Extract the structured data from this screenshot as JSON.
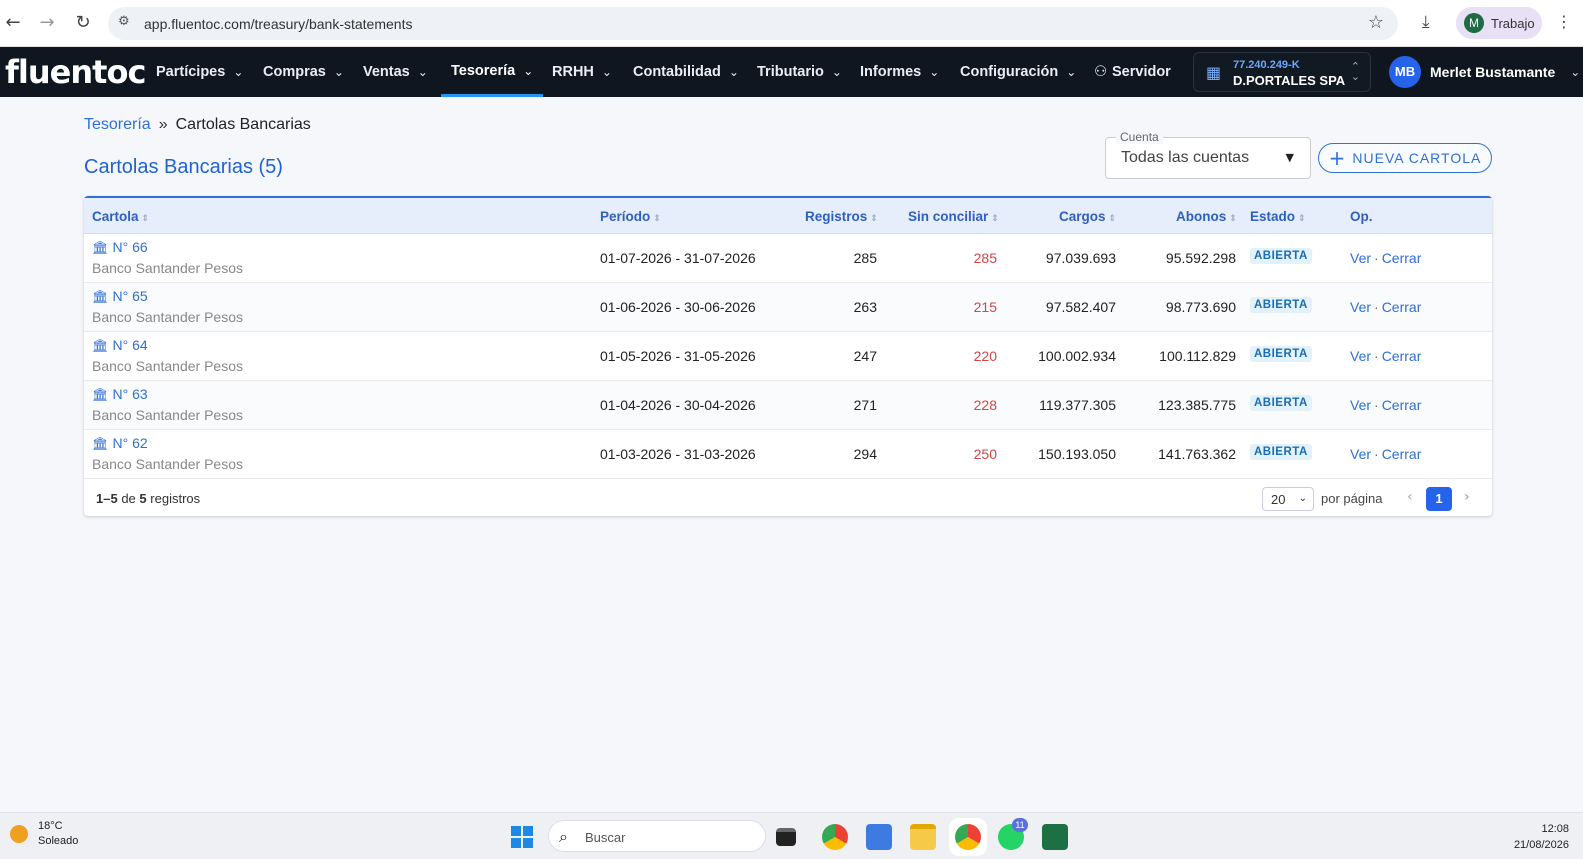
{
  "browser": {
    "url": "app.fluentoc.com/treasury/bank-statements",
    "profile_initial": "M",
    "profile_label": "Trabajo"
  },
  "app": {
    "logo": "fluentoc",
    "menu": [
      {
        "label": "Partícipes",
        "active": false
      },
      {
        "label": "Compras",
        "active": false
      },
      {
        "label": "Ventas",
        "active": false
      },
      {
        "label": "Tesorería",
        "active": true
      },
      {
        "label": "RRHH",
        "active": false
      },
      {
        "label": "Contabilidad",
        "active": false
      },
      {
        "label": "Tributario",
        "active": false
      },
      {
        "label": "Informes",
        "active": false
      },
      {
        "label": "Configuración",
        "active": false
      }
    ],
    "server_label": "Servidor",
    "company": {
      "rut": "77.240.249-K",
      "name": "D.PORTALES SPA"
    },
    "user": {
      "initials": "MB",
      "name": "Merlet Bustamante"
    }
  },
  "breadcrumb": {
    "parent": "Tesorería",
    "separator": "»",
    "current": "Cartolas Bancarias"
  },
  "page_title": "Cartolas Bancarias (5)",
  "account_filter": {
    "label": "Cuenta",
    "value": "Todas las cuentas"
  },
  "new_button": "NUEVA CARTOLA",
  "table": {
    "headers": {
      "cartola": "Cartola",
      "periodo": "Período",
      "registros": "Registros",
      "sin_conciliar": "Sin conciliar",
      "cargos": "Cargos",
      "abonos": "Abonos",
      "estado": "Estado",
      "op": "Op."
    },
    "rows": [
      {
        "id": "N° 66",
        "bank": "Banco Santander Pesos",
        "periodo": "01-07-2026 - 31-07-2026",
        "registros": "285",
        "sin_conciliar": "285",
        "cargos": "97.039.693",
        "abonos": "95.592.298",
        "estado": "ABIERTA",
        "ver": "Ver",
        "cerrar": "Cerrar"
      },
      {
        "id": "N° 65",
        "bank": "Banco Santander Pesos",
        "periodo": "01-06-2026 - 30-06-2026",
        "registros": "263",
        "sin_conciliar": "215",
        "cargos": "97.582.407",
        "abonos": "98.773.690",
        "estado": "ABIERTA",
        "ver": "Ver",
        "cerrar": "Cerrar"
      },
      {
        "id": "N° 64",
        "bank": "Banco Santander Pesos",
        "periodo": "01-05-2026 - 31-05-2026",
        "registros": "247",
        "sin_conciliar": "220",
        "cargos": "100.002.934",
        "abonos": "100.112.829",
        "estado": "ABIERTA",
        "ver": "Ver",
        "cerrar": "Cerrar"
      },
      {
        "id": "N° 63",
        "bank": "Banco Santander Pesos",
        "periodo": "01-04-2026 - 30-04-2026",
        "registros": "271",
        "sin_conciliar": "228",
        "cargos": "119.377.305",
        "abonos": "123.385.775",
        "estado": "ABIERTA",
        "ver": "Ver",
        "cerrar": "Cerrar"
      },
      {
        "id": "N° 62",
        "bank": "Banco Santander Pesos",
        "periodo": "01-03-2026 - 31-03-2026",
        "registros": "294",
        "sin_conciliar": "250",
        "cargos": "150.193.050",
        "abonos": "141.763.362",
        "estado": "ABIERTA",
        "ver": "Ver",
        "cerrar": "Cerrar"
      }
    ]
  },
  "footer": {
    "range": "1–5",
    "de": "de",
    "total": "5",
    "registros": "registros",
    "per_page": "20",
    "per_page_label": "por página",
    "page": "1"
  },
  "taskbar": {
    "temp": "18°C",
    "weather": "Soleado",
    "search_placeholder": "Buscar",
    "whatsapp_badge": "11",
    "time": "12:08",
    "date": "21/08/2026"
  },
  "colors": {
    "accent": "#2f6fd6",
    "nav_bg": "#0f1620",
    "unreconciled": "#d64545",
    "badge_bg": "#e3f1fb"
  }
}
